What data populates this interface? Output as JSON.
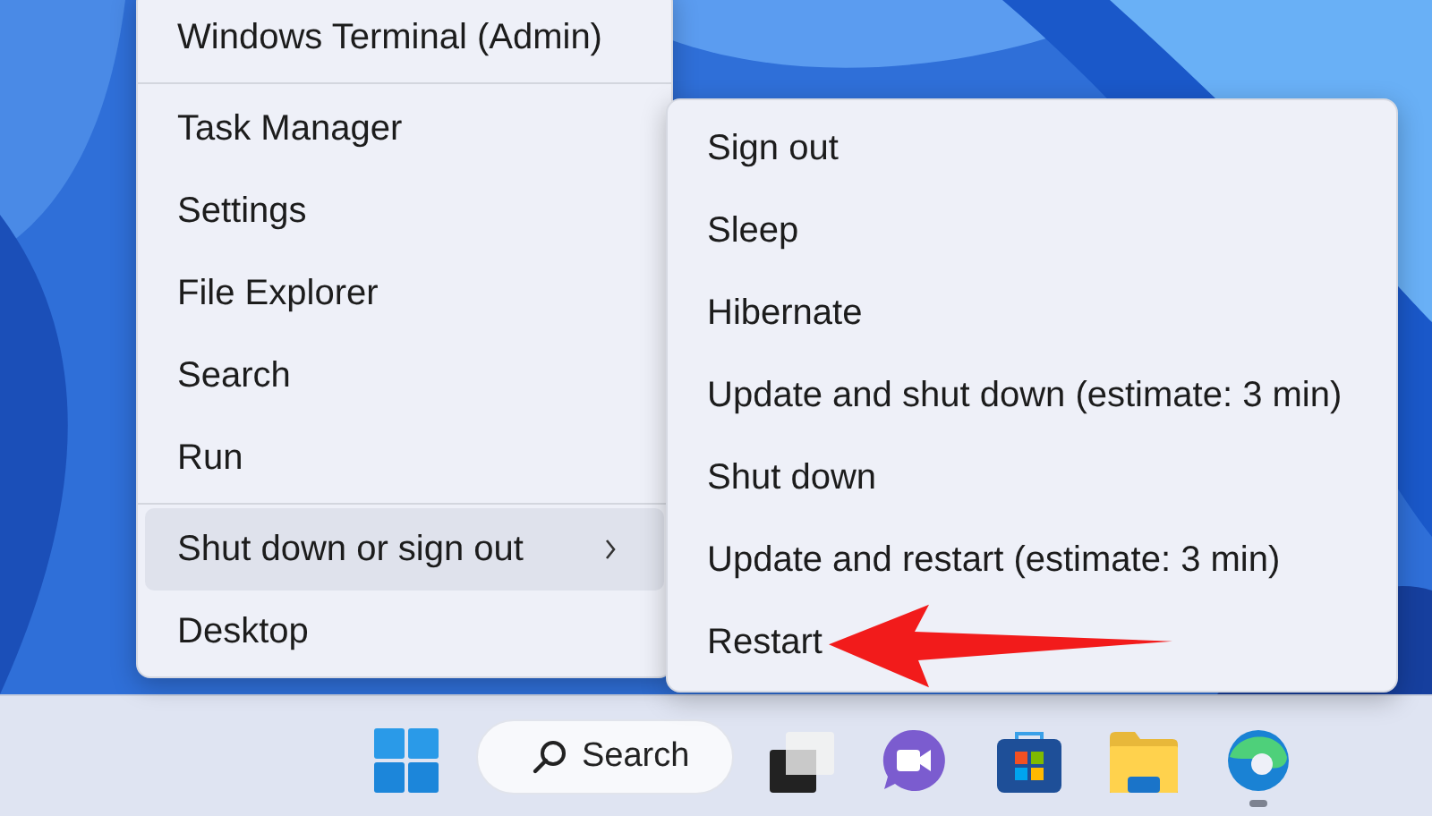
{
  "power_menu": {
    "items": [
      {
        "kind": "item",
        "label": "Windows Terminal (Admin)",
        "selected": false,
        "submenu": false
      },
      {
        "kind": "separator"
      },
      {
        "kind": "item",
        "label": "Task Manager",
        "selected": false,
        "submenu": false
      },
      {
        "kind": "item",
        "label": "Settings",
        "selected": false,
        "submenu": false
      },
      {
        "kind": "item",
        "label": "File Explorer",
        "selected": false,
        "submenu": false
      },
      {
        "kind": "item",
        "label": "Search",
        "selected": false,
        "submenu": false
      },
      {
        "kind": "item",
        "label": "Run",
        "selected": false,
        "submenu": false
      },
      {
        "kind": "separator"
      },
      {
        "kind": "item",
        "label": "Shut down or sign out",
        "selected": true,
        "submenu": true
      },
      {
        "kind": "item",
        "label": "Desktop",
        "selected": false,
        "submenu": false
      }
    ]
  },
  "submenu": {
    "items": [
      {
        "label": "Sign out"
      },
      {
        "label": "Sleep"
      },
      {
        "label": "Hibernate"
      },
      {
        "label": "Update and shut down (estimate: 3 min)"
      },
      {
        "label": "Shut down"
      },
      {
        "label": "Update and restart (estimate: 3 min)"
      },
      {
        "label": "Restart"
      }
    ]
  },
  "taskbar": {
    "search": {
      "placeholder": "Search"
    },
    "apps": [
      {
        "kind": "start",
        "running": false
      },
      {
        "kind": "search"
      },
      {
        "kind": "task-view",
        "running": false
      },
      {
        "kind": "chat",
        "running": false
      },
      {
        "kind": "store",
        "running": false
      },
      {
        "kind": "files",
        "running": false
      },
      {
        "kind": "browser",
        "running": true
      }
    ]
  }
}
